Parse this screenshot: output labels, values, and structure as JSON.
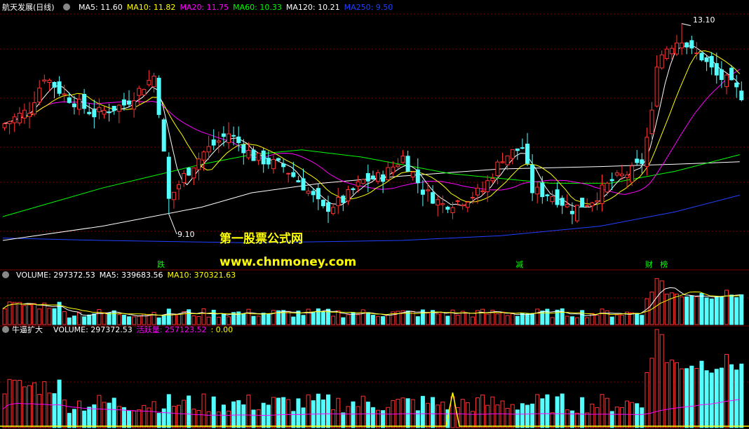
{
  "header": {
    "stock_name": "航天发展(日线)",
    "main_indicators": [
      {
        "label": "MA5: 11.60",
        "color": "#ffffff"
      },
      {
        "label": "MA10: 11.82",
        "color": "#ffff00"
      },
      {
        "label": "MA20: 11.75",
        "color": "#ff00ff"
      },
      {
        "label": "MA60: 10.33",
        "color": "#00ff00"
      },
      {
        "label": "MA120: 10.21",
        "color": "#ffffff"
      },
      {
        "label": "MA250: 9.50",
        "color": "#2040ff"
      }
    ],
    "volume_indicators": [
      {
        "label": "VOLUME: 297372.53",
        "color": "#ffffff"
      },
      {
        "label": "MA5: 339683.56",
        "color": "#ffffff"
      },
      {
        "label": "MA10: 370321.63",
        "color": "#ffff00"
      }
    ],
    "third_title": "牛逼扩大",
    "third_indicators": [
      {
        "label": "VOLUME: 297372.53",
        "color": "#ffffff"
      },
      {
        "label": "活跃量: 257123.52",
        "color": "#ff00ff"
      },
      {
        "label": ": 0.00",
        "color": "#ffff00"
      }
    ]
  },
  "watermark": {
    "line1": "第一股票公式网",
    "line2": "www.chnmoney.com",
    "color": "#ffff00"
  },
  "chart_data": {
    "type": "candlestick",
    "price_min": 8.3,
    "price_max": 13.3,
    "annotations": {
      "high_label": "13.10",
      "low_label": "9.10",
      "markers": [
        {
          "text": "跌",
          "index": 31,
          "color": "#00ff00"
        },
        {
          "text": "减",
          "index": 103,
          "color": "#00ff00"
        },
        {
          "text": "财",
          "index": 129,
          "color": "#00ff00"
        },
        {
          "text": "榜",
          "index": 132,
          "color": "#00ff00"
        }
      ]
    },
    "colors": {
      "up": "#ff3232",
      "down": "#54ffff",
      "ma5": "#ffffff",
      "ma10": "#ffff00",
      "ma20": "#ff00ff",
      "ma60": "#00ff00",
      "ma120": "#ffffff",
      "ma250": "#2040ff",
      "grid": "#800000",
      "active": "#ff00ff",
      "signal": "#ffff00"
    },
    "ma60": [
      [
        0,
        9.05
      ],
      [
        20,
        9.65
      ],
      [
        40,
        10.15
      ],
      [
        50,
        10.35
      ],
      [
        60,
        10.45
      ],
      [
        72,
        10.3
      ],
      [
        90,
        9.95
      ],
      [
        110,
        9.75
      ],
      [
        122,
        9.75
      ],
      [
        135,
        10.0
      ],
      [
        148,
        10.35
      ]
    ],
    "ma120": [
      [
        0,
        8.55
      ],
      [
        20,
        8.85
      ],
      [
        40,
        9.25
      ],
      [
        50,
        9.55
      ],
      [
        64,
        9.75
      ],
      [
        80,
        9.9
      ],
      [
        100,
        10.05
      ],
      [
        120,
        10.1
      ],
      [
        135,
        10.15
      ],
      [
        148,
        10.2
      ]
    ],
    "ma250": [
      [
        0,
        8.6
      ],
      [
        20,
        8.55
      ],
      [
        50,
        8.5
      ],
      [
        80,
        8.55
      ],
      [
        100,
        8.65
      ],
      [
        120,
        8.85
      ],
      [
        135,
        9.15
      ],
      [
        148,
        9.5
      ]
    ],
    "volume_signal_index": 90
  }
}
